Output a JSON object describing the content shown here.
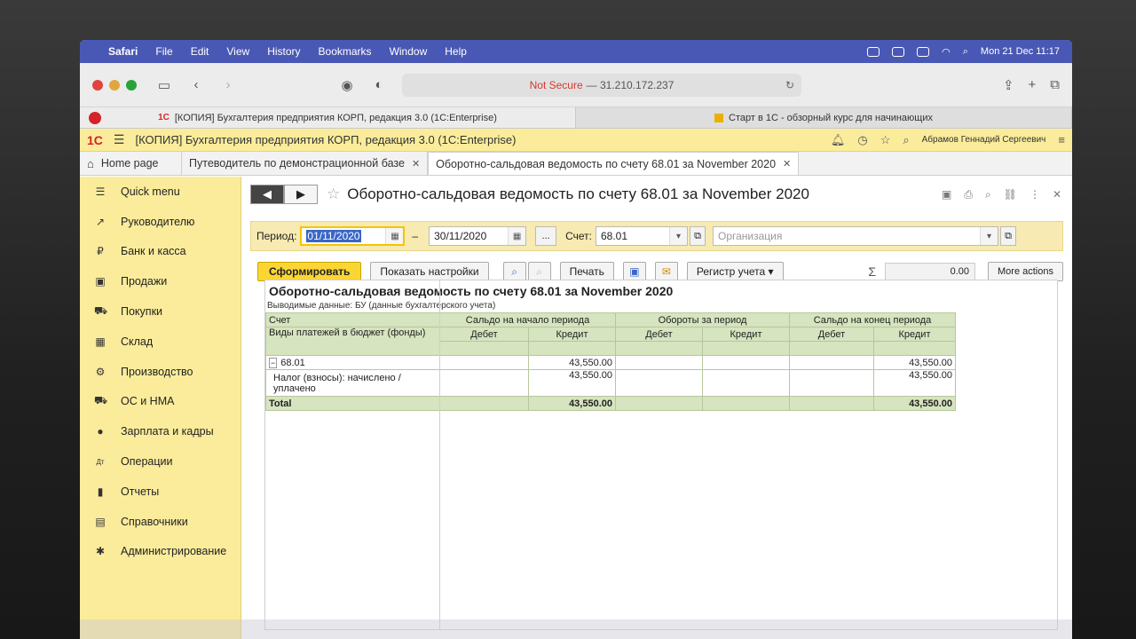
{
  "menubar": {
    "app": "Safari",
    "items": [
      "File",
      "Edit",
      "View",
      "History",
      "Bookmarks",
      "Window",
      "Help"
    ],
    "clock": "Mon 21 Dec  11:17"
  },
  "safari": {
    "not_secure": "Not Secure",
    "url": "— 31.210.172.237",
    "tabs": [
      {
        "label": "[КОПИЯ] Бухгалтерия предприятия КОРП, редакция 3.0 (1С:Enterprise)",
        "favicon": "1С"
      },
      {
        "label": "Старт в 1С - обзорный курс для начинающих"
      }
    ]
  },
  "c1": {
    "logo": "1С",
    "title": "[КОПИЯ] Бухгалтерия предприятия КОРП, редакция 3.0  (1С:Enterprise)",
    "user": "Абрамов Геннадий Сергеевич",
    "tabs": [
      {
        "label": "Home page"
      },
      {
        "label": "Путеводитель по демонстрационной базе"
      },
      {
        "label": "Оборотно-сальдовая ведомость по счету 68.01 за November 2020"
      }
    ]
  },
  "sidebar": {
    "items": [
      {
        "label": "Quick menu",
        "icon": "☰"
      },
      {
        "label": "Руководителю",
        "icon": "↗"
      },
      {
        "label": "Банк и касса",
        "icon": "₽"
      },
      {
        "label": "Продажи",
        "icon": "▣"
      },
      {
        "label": "Покупки",
        "icon": "⛟"
      },
      {
        "label": "Склад",
        "icon": "▦"
      },
      {
        "label": "Производство",
        "icon": "⚙"
      },
      {
        "label": "ОС и НМА",
        "icon": "⛟"
      },
      {
        "label": "Зарплата и кадры",
        "icon": "●"
      },
      {
        "label": "Операции",
        "icon": "Дт"
      },
      {
        "label": "Отчеты",
        "icon": "▮"
      },
      {
        "label": "Справочники",
        "icon": "▤"
      },
      {
        "label": "Администрирование",
        "icon": "✱"
      }
    ]
  },
  "doc": {
    "title": "Оборотно-сальдовая ведомость по счету 68.01 за November 2020",
    "period_label": "Период:",
    "period_from": "01/11/2020",
    "period_to": "30/11/2020",
    "period_dash": "–",
    "ellipsis": "...",
    "account_label": "Счет:",
    "account": "68.01",
    "org_placeholder": "Организация",
    "btn_generate": "Сформировать",
    "btn_settings": "Показать настройки",
    "btn_print": "Печать",
    "btn_register": "Регистр учета",
    "sum_value": "0.00",
    "more_actions": "More actions"
  },
  "report": {
    "title": "Оборотно-сальдовая ведомость по счету 68.01 за November 2020",
    "subtitle": "Выводимые данные:  БУ (данные бухгалтерского учета)",
    "col_account": "Счет",
    "col_types": "Виды платежей в бюджет (фонды)",
    "col_open": "Сальдо на начало периода",
    "col_turn": "Обороты за период",
    "col_close": "Сальдо на конец периода",
    "debit": "Дебет",
    "credit": "Кредит",
    "row_account": "68.01",
    "row_account_open_credit": "43,550.00",
    "row_account_close_credit": "43,550.00",
    "row_sub": "Налог (взносы): начислено / уплачено",
    "row_sub_open_credit": "43,550.00",
    "row_sub_close_credit": "43,550.00",
    "total_label": "Total",
    "total_open_credit": "43,550.00",
    "total_close_credit": "43,550.00"
  }
}
